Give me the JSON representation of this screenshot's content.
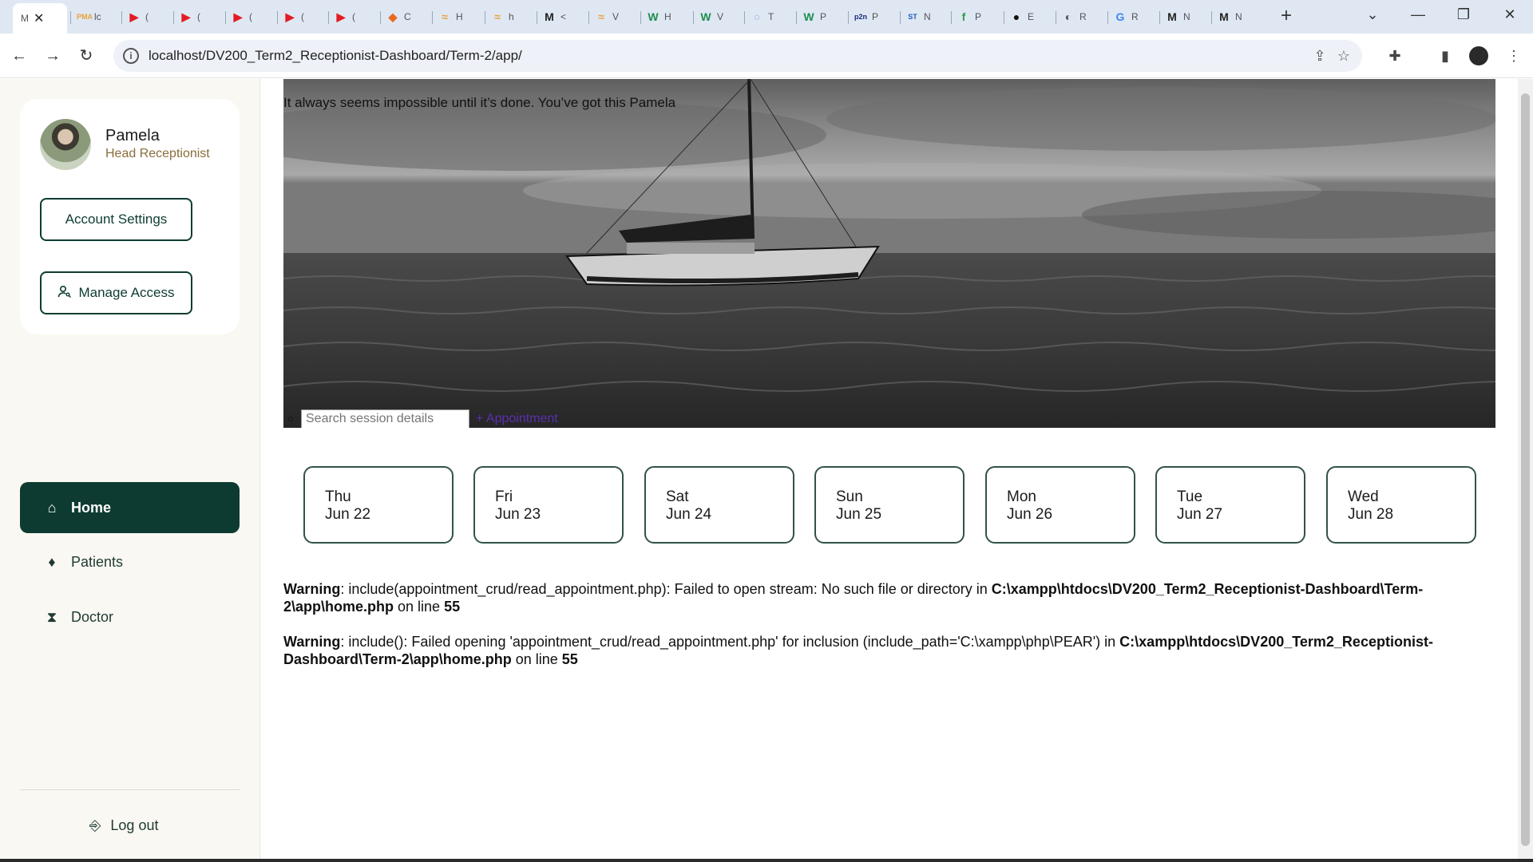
{
  "browser": {
    "active_tab_label": "M",
    "tabs": [
      {
        "glyph": "PMA",
        "label": "lc",
        "color": "#e8a33a"
      },
      {
        "glyph": "▶",
        "label": "(",
        "color": "#e31b23"
      },
      {
        "glyph": "▶",
        "label": "(",
        "color": "#e31b23"
      },
      {
        "glyph": "▶",
        "label": "(",
        "color": "#e31b23"
      },
      {
        "glyph": "▶",
        "label": "(",
        "color": "#e31b23"
      },
      {
        "glyph": "▶",
        "label": "(",
        "color": "#e31b23"
      },
      {
        "glyph": "◆",
        "label": "C",
        "color": "#e86a1c"
      },
      {
        "glyph": "≈",
        "label": "H",
        "color": "#e8a33a"
      },
      {
        "glyph": "≈",
        "label": "h",
        "color": "#e8a33a"
      },
      {
        "glyph": "M",
        "label": "<",
        "color": "#222222"
      },
      {
        "glyph": "≈",
        "label": "V",
        "color": "#e8a33a"
      },
      {
        "glyph": "W",
        "label": "H",
        "color": "#1e8f4e"
      },
      {
        "glyph": "W",
        "label": "V",
        "color": "#1e8f4e"
      },
      {
        "glyph": "○",
        "label": "T",
        "color": "#8fb0e8"
      },
      {
        "glyph": "W",
        "label": "P",
        "color": "#1e8f4e"
      },
      {
        "glyph": "p2n",
        "label": "P",
        "color": "#1a2a7a"
      },
      {
        "glyph": "ST",
        "label": "N",
        "color": "#1a5fb4"
      },
      {
        "glyph": "f",
        "label": "P",
        "color": "#2e9b4a"
      },
      {
        "glyph": "●",
        "label": "E",
        "color": "#111111"
      },
      {
        "glyph": "◐",
        "label": "R",
        "color": "#555555"
      },
      {
        "glyph": "G",
        "label": "R",
        "color": "#4285f4"
      },
      {
        "glyph": "M",
        "label": "N",
        "color": "#222222"
      },
      {
        "glyph": "M",
        "label": "N",
        "color": "#222222"
      }
    ],
    "url": "localhost/DV200_Term2_Receptionist-Dashboard/Term-2/app/"
  },
  "sidebar": {
    "user_name": "Pamela",
    "user_role": "Head Receptionist",
    "account_settings_label": "Account Settings",
    "manage_access_label": "Manage Access",
    "nav": [
      {
        "label": "Home",
        "icon": "home-icon",
        "active": true
      },
      {
        "label": "Patients",
        "icon": "patients-icon",
        "active": false
      },
      {
        "label": "Doctor",
        "icon": "doctor-icon",
        "active": false
      }
    ],
    "logout_label": "Log out"
  },
  "hero": {
    "quote": "It always seems impossible until it’s done. You’ve got this Pamela",
    "search_placeholder": "Search session details",
    "add_link": "+ Appointment"
  },
  "days": [
    {
      "weekday": "Thu",
      "date": "Jun 22"
    },
    {
      "weekday": "Fri",
      "date": "Jun 23"
    },
    {
      "weekday": "Sat",
      "date": "Jun 24"
    },
    {
      "weekday": "Sun",
      "date": "Jun 25"
    },
    {
      "weekday": "Mon",
      "date": "Jun 26"
    },
    {
      "weekday": "Tue",
      "date": "Jun 27"
    },
    {
      "weekday": "Wed",
      "date": "Jun 28"
    }
  ],
  "warnings": [
    {
      "label": "Warning",
      "message": ": include(appointment_crud/read_appointment.php): Failed to open stream: No such file or directory in ",
      "path": "C:\\xampp\\htdocs\\DV200_Term2_Receptionist-Dashboard\\Term-2\\app\\home.php",
      "line_text": " on line ",
      "line": "55"
    },
    {
      "label": "Warning",
      "message": ": include(): Failed opening 'appointment_crud/read_appointment.php' for inclusion (include_path='C:\\xampp\\php\\PEAR') in ",
      "path": "C:\\xampp\\htdocs\\DV200_Term2_Receptionist-Dashboard\\Term-2\\app\\home.php",
      "line_text": " on line ",
      "line": "55"
    }
  ],
  "colors": {
    "primary": "#0d3b32",
    "link": "#5b2fb0",
    "role": "#8a6d3b"
  }
}
